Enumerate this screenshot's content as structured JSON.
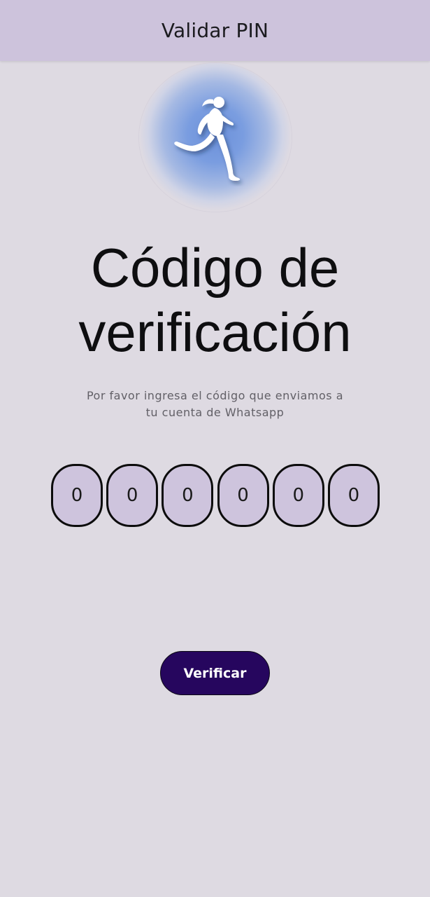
{
  "appbar": {
    "title": "Validar PIN",
    "background": "#cdc3dc"
  },
  "logo": {
    "icon": "runner-icon",
    "glow_color": "#6b90d9"
  },
  "main": {
    "heading_line1": "Código de",
    "heading_line2": "verificación",
    "subtitle_line1": "Por favor ingresa el código que enviamos a",
    "subtitle_line2": "tu cuenta de Whatsapp"
  },
  "pin": {
    "digits": [
      "0",
      "0",
      "0",
      "0",
      "0",
      "0"
    ],
    "box_color": "#cec4dd"
  },
  "actions": {
    "verify_label": "Verificar",
    "verify_color": "#26065e"
  }
}
